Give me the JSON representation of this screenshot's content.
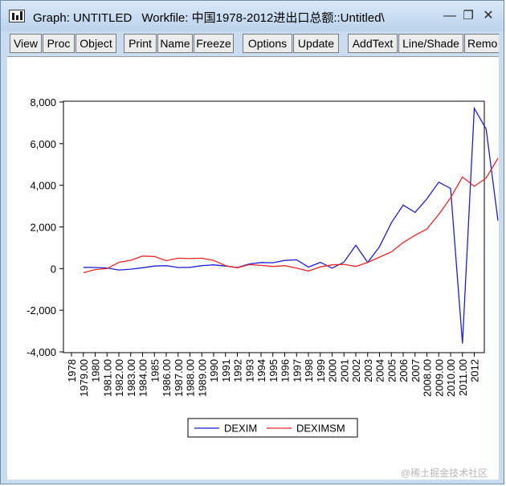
{
  "window": {
    "title": "Graph: UNTITLED",
    "workfile": "Workfile: 中国1978-2012进出口总额::Untitled\\",
    "minimize_glyph": "—",
    "maximize_glyph": "❐",
    "close_glyph": "✕"
  },
  "toolbar": {
    "buttons": [
      "View",
      "Proc",
      "Object",
      "Print",
      "Name",
      "Freeze",
      "Options",
      "Update",
      "AddText",
      "Line/Shade",
      "Remo"
    ]
  },
  "watermark": "@稀土掘金技术社区",
  "colors": {
    "series1": "#1f1fd6",
    "series2": "#e32626",
    "window_bg": "#c9dcf0"
  },
  "chart_data": {
    "type": "line",
    "title": "",
    "xlabel": "",
    "ylabel": "",
    "ylim": [
      -4000,
      8000
    ],
    "yticks": [
      -4000,
      -2000,
      0,
      2000,
      4000,
      6000,
      8000
    ],
    "ytick_labels": [
      "-4,000",
      "-2,000",
      "0",
      "2,000",
      "4,000",
      "6,000",
      "8,000"
    ],
    "x_tick_labels": [
      "1978",
      "1979.00",
      "1980",
      "1981.00",
      "1982.00",
      "1983.00",
      "1984.00",
      "1985",
      "1986.00",
      "1987.00",
      "1988.00",
      "1989.00",
      "1990",
      "1991",
      "1992",
      "1993",
      "1994",
      "1995",
      "1996",
      "1997",
      "1998",
      "1999",
      "2000",
      "2001",
      "2002",
      "2003",
      "2004",
      "2005",
      "2006",
      "2007",
      "2008.00",
      "2009.00",
      "2010.00",
      "2011.00",
      "2012"
    ],
    "legend_position": "bottom-center",
    "grid": false,
    "series": [
      {
        "name": "DEXIM",
        "color": "#1f1fd6",
        "start_index": 1,
        "values": [
          60,
          50,
          30,
          -70,
          -30,
          40,
          120,
          140,
          50,
          60,
          140,
          180,
          120,
          50,
          220,
          290,
          280,
          390,
          420,
          70,
          300,
          20,
          310,
          1120,
          300,
          1050,
          2200,
          3050,
          2700,
          3350,
          4150,
          3850,
          -3600,
          7700,
          6700,
          2300
        ]
      },
      {
        "name": "DEXIMSM",
        "color": "#e32626",
        "start_index": 1,
        "values": [
          -200,
          -50,
          0,
          300,
          400,
          600,
          580,
          380,
          500,
          480,
          500,
          390,
          140,
          40,
          190,
          150,
          100,
          140,
          20,
          -120,
          80,
          180,
          200,
          100,
          300,
          550,
          800,
          1250,
          1600,
          1900,
          2600,
          3400,
          4400,
          3950,
          4350,
          5300
        ]
      }
    ]
  }
}
